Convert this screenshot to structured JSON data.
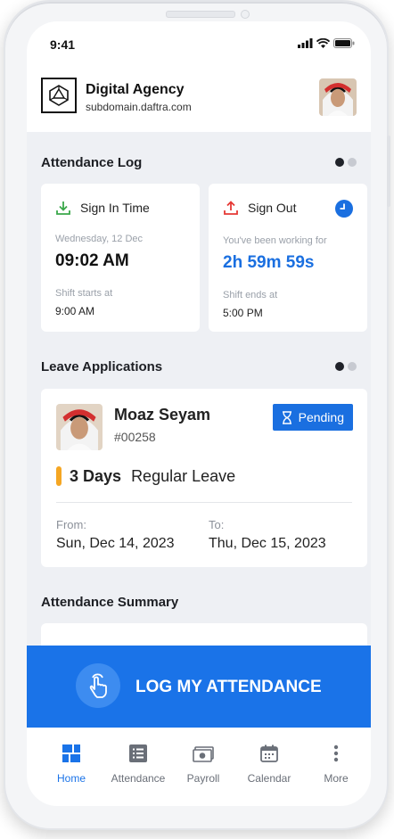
{
  "status_bar": {
    "time": "9:41"
  },
  "header": {
    "company_name": "Digital Agency",
    "subdomain": "subdomain.daftra.com"
  },
  "attendance_log": {
    "title": "Attendance Log",
    "sign_in": {
      "label": "Sign In Time",
      "date": "Wednesday, 12 Dec",
      "time": "09:02 AM",
      "shift_label": "Shift starts at",
      "shift_time": "9:00 AM"
    },
    "sign_out": {
      "label": "Sign Out",
      "working_label": "You've been working for",
      "duration": "2h 59m 59s",
      "shift_label": "Shift ends at",
      "shift_time": "5:00 PM"
    }
  },
  "leave_applications": {
    "title": "Leave Applications",
    "item": {
      "name": "Moaz Seyam",
      "employee_id": "#00258",
      "status": "Pending",
      "days": "3 Days",
      "leave_type": "Regular Leave",
      "from_label": "From:",
      "from_date": "Sun, Dec 14, 2023",
      "to_label": "To:",
      "to_date": "Thu, Dec 15, 2023"
    }
  },
  "attendance_summary": {
    "title": "Attendance Summary"
  },
  "cta": {
    "label": "LOG MY ATTENDANCE"
  },
  "bottom_nav": {
    "items": [
      {
        "label": "Home",
        "icon": "home-grid-icon",
        "active": true
      },
      {
        "label": "Attendance",
        "icon": "list-icon"
      },
      {
        "label": "Payroll",
        "icon": "money-icon"
      },
      {
        "label": "Calendar",
        "icon": "calendar-icon"
      },
      {
        "label": "More",
        "icon": "more-vertical-icon"
      }
    ]
  },
  "colors": {
    "accent": "#1a73e8",
    "pending": "#1a6fe0",
    "leave_bar": "#f5a623",
    "sign_in_icon": "#3aa84a",
    "sign_out_icon": "#e53935"
  }
}
